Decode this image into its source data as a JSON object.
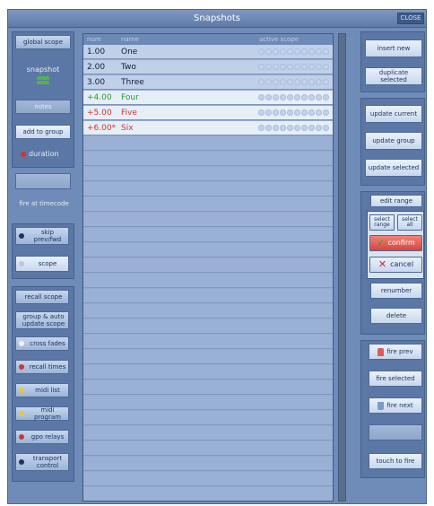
{
  "window": {
    "title": "Snapshots",
    "close_label": "CLOSE"
  },
  "left_panel": {
    "global_scope": "global scope",
    "snapshot_label": "snapshot",
    "notes": "notes",
    "add_to_group": "add to group",
    "duration": "duration",
    "fire_at_timecode": "fire at timecode",
    "skip_prev_fwd": "skip prev/fwd",
    "scope": "scope",
    "recall_scope": "recall scope",
    "group_auto_update_scope": "group & auto update scope",
    "cross_fades": "cross fades",
    "recall_times": "recall times",
    "midi_list": "midi list",
    "midi_program": "midi program",
    "gpo_relays": "gpo relays",
    "transport_control": "transport control"
  },
  "table": {
    "columns": [
      "num",
      "name",
      "active scope"
    ],
    "rows": [
      {
        "num": "1.00",
        "name": "One",
        "style": "plain"
      },
      {
        "num": "2.00",
        "name": "Two",
        "style": "plain"
      },
      {
        "num": "3.00",
        "name": "Three",
        "style": "plain"
      },
      {
        "num": "+4.00",
        "name": "Four",
        "style": "green"
      },
      {
        "num": "+5.00",
        "name": "Five",
        "style": "red"
      },
      {
        "num": "+6.00*",
        "name": "Six",
        "style": "red"
      }
    ]
  },
  "right_panel": {
    "insert_new": "insert new",
    "duplicate_selected": "duplicate selected",
    "update_current": "update current",
    "update_group": "update group",
    "update_selected": "update selected",
    "edit_range": "edit range",
    "select_range": "select range",
    "select_all": "select all",
    "confirm": "confirm",
    "cancel": "cancel",
    "renumber": "renumber",
    "delete": "delete",
    "fire_prev": "fire prev",
    "fire_selected": "fire selected",
    "fire_next": "fire next",
    "touch_to_fire": "touch to fire"
  },
  "colors": {
    "green_text": "#2c9a2c",
    "red_text": "#d23434",
    "confirm": "#e0483c",
    "duration_dot": "#d23434"
  }
}
